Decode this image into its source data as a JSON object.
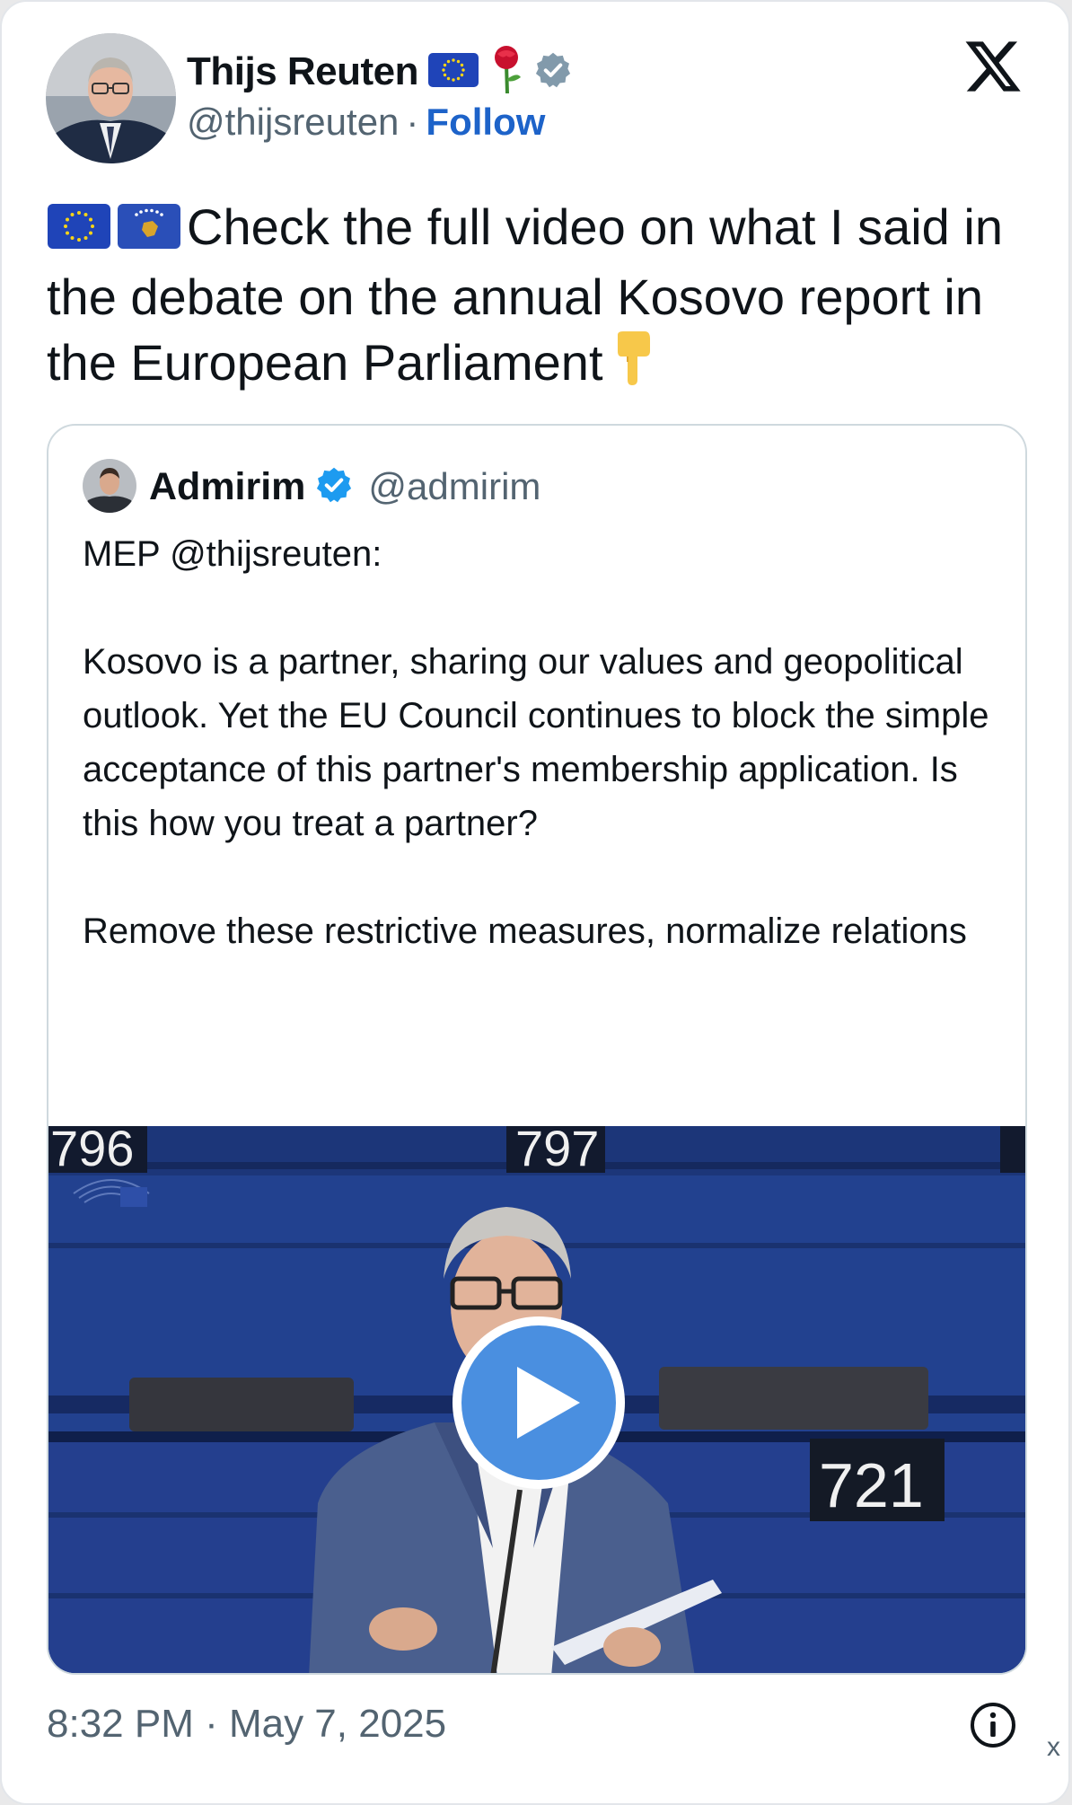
{
  "author": {
    "display_name": "Thijs Reuten",
    "handle": "@thijsreuten",
    "separator": "·",
    "follow_label": "Follow"
  },
  "tweet": {
    "text": "Check the full video on what I said in the debate on the annual Kosovo report in the European Parliament"
  },
  "quoted_tweet": {
    "display_name": "Admirim",
    "handle": "@admirim",
    "paragraphs": [
      "MEP @thijsreuten:",
      "Kosovo is a partner, sharing our values and geopolitical outlook. Yet the EU Council continues to block the simple acceptance of this partner's membership application. Is this how you treat a partner?",
      "Remove these restrictive measures, normalize relations"
    ],
    "video": {
      "seat_numbers": [
        "796",
        "797",
        "721"
      ]
    }
  },
  "footer": {
    "timestamp": "8:32 PM · May 7, 2025",
    "close_label": "x"
  },
  "colors": {
    "follow": "#1d63c9",
    "verified_gray": "#829aab",
    "verified_blue": "#1d9bf0",
    "play_button": "#4a8fe0"
  },
  "icons": [
    "eu-flag-icon",
    "rose-icon",
    "verified-badge-icon",
    "x-logo-icon",
    "kosovo-flag-icon",
    "pointing-down-icon",
    "play-icon",
    "info-icon"
  ]
}
